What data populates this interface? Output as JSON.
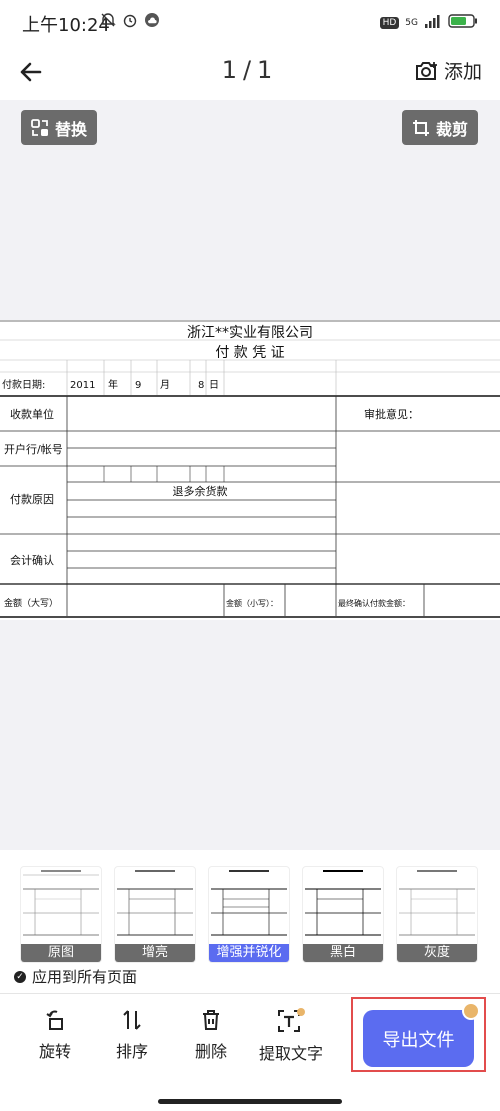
{
  "status": {
    "time": "上午10:24",
    "hd": "HD",
    "network": "5G"
  },
  "header": {
    "page_indicator": "1/1",
    "add_label": "添加"
  },
  "canvas": {
    "replace_label": "替换",
    "crop_label": "裁剪"
  },
  "document": {
    "company": "浙江**实业有限公司",
    "title": "付 款 凭 证",
    "date_label": "付款日期:",
    "year": "2011",
    "year_unit": "年",
    "month": "9",
    "month_unit": "月",
    "day": "8",
    "day_unit": "日",
    "payee_label": "收款单位",
    "approval_label": "审批意见：",
    "bank_label": "开户行/帐号",
    "reason_label": "付款原因",
    "reason_value": "退多余货款",
    "accounting_label": "会计确认",
    "amount_upper_label": "金额（大写）",
    "amount_lower_label": "金额（小写）：",
    "final_label": "最终确认付款金额："
  },
  "filters": [
    {
      "label": "原图"
    },
    {
      "label": "增亮"
    },
    {
      "label": "增强并锐化"
    },
    {
      "label": "黑白"
    },
    {
      "label": "灰度"
    }
  ],
  "apply_all_label": "应用到所有页面",
  "actions": {
    "rotate": "旋转",
    "sort": "排序",
    "delete": "删除",
    "extract": "提取文字"
  },
  "export_label": "导出文件",
  "colors": {
    "accent": "#5b6cf0",
    "highlight_border": "#e24c4c"
  }
}
